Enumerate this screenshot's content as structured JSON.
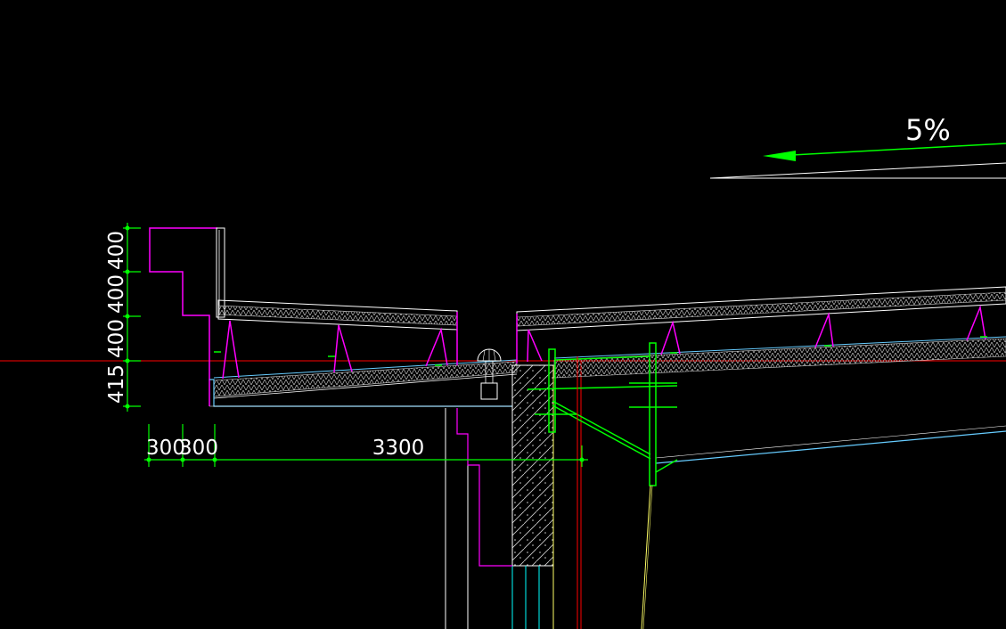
{
  "slope": {
    "label": "5%"
  },
  "dimensions": {
    "vertical": [
      "400",
      "400",
      "400",
      "415"
    ],
    "horizontal": [
      "300",
      "300",
      "3300"
    ]
  },
  "colors": {
    "background": "#000000",
    "dimension": "#00ff00",
    "parapet": "#ff00ff",
    "outline": "#ffffff",
    "ceiling": "#66ccff",
    "reference": "#ff0000",
    "column": "#ffff66",
    "structure": "#00ffff"
  }
}
